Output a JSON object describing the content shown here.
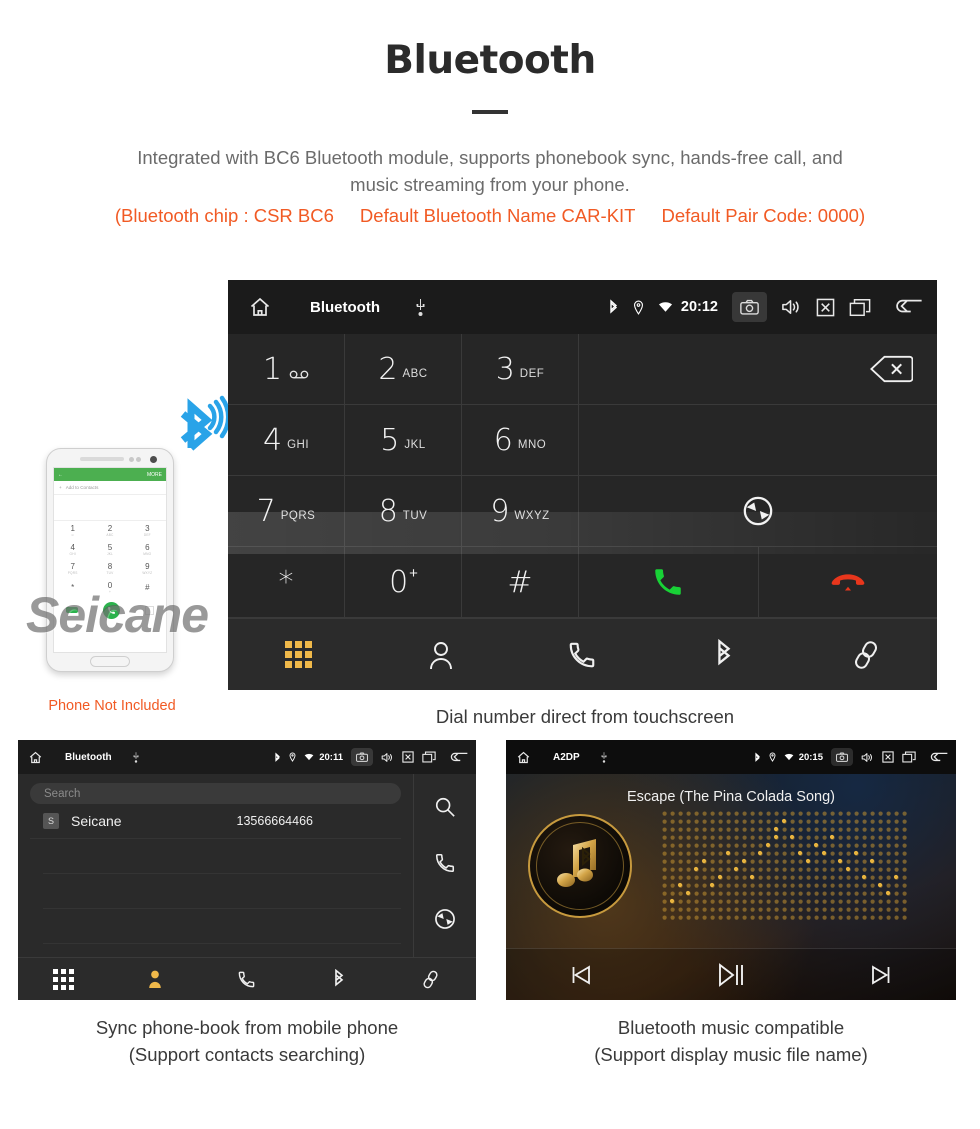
{
  "header": {
    "title": "Bluetooth",
    "intro_line1": "Integrated with BC6 Bluetooth module, supports phonebook sync, hands-free call, and",
    "intro_line2": "music streaming from your phone.",
    "spec_chip": "(Bluetooth chip : CSR BC6",
    "spec_name": "Default Bluetooth Name CAR-KIT",
    "spec_pair": "Default Pair Code: 0000)",
    "accent_color": "#f15a24",
    "text_color": "#6b6b6b"
  },
  "dialer": {
    "statusbar": {
      "title": "Bluetooth",
      "clock": "20:12",
      "icons": [
        "home-icon",
        "usb-icon",
        "bluetooth-icon",
        "location-icon",
        "wifi-icon",
        "camera-icon",
        "volume-icon",
        "close-icon",
        "recent-apps-icon",
        "back-icon"
      ]
    },
    "keys": [
      {
        "digit": "1",
        "letters": "",
        "glyph": "voicemail"
      },
      {
        "digit": "2",
        "letters": "ABC",
        "glyph": ""
      },
      {
        "digit": "3",
        "letters": "DEF",
        "glyph": ""
      },
      {
        "digit": "4",
        "letters": "GHI",
        "glyph": ""
      },
      {
        "digit": "5",
        "letters": "JKL",
        "glyph": ""
      },
      {
        "digit": "6",
        "letters": "MNO",
        "glyph": ""
      },
      {
        "digit": "7",
        "letters": "PQRS",
        "glyph": ""
      },
      {
        "digit": "8",
        "letters": "TUV",
        "glyph": ""
      },
      {
        "digit": "9",
        "letters": "WXYZ",
        "glyph": ""
      },
      {
        "digit": "*",
        "letters": "",
        "glyph": ""
      },
      {
        "digit": "0",
        "letters": "",
        "glyph": "plus"
      },
      {
        "digit": "#",
        "letters": "",
        "glyph": ""
      }
    ],
    "side_actions": {
      "backspace": "backspace-icon",
      "sync": "sync-icon",
      "call": "call-icon",
      "hangup": "hangup-icon",
      "call_color": "#18d136",
      "hangup_color": "#e8361c"
    },
    "navbar": {
      "items": [
        "dialpad",
        "contacts",
        "call-log",
        "bluetooth",
        "pair"
      ],
      "active": "dialpad",
      "active_color": "#f0b94a"
    },
    "caption": "Dial number direct from touchscreen"
  },
  "phone_mockup": {
    "topbar_back": "←",
    "topbar_more": "MORE",
    "add_label": "Add to Contacts",
    "keys": [
      {
        "d": "1",
        "s": "∞"
      },
      {
        "d": "2",
        "s": "ABC"
      },
      {
        "d": "3",
        "s": "DEF"
      },
      {
        "d": "4",
        "s": "GHI"
      },
      {
        "d": "5",
        "s": "JKL"
      },
      {
        "d": "6",
        "s": "MNO"
      },
      {
        "d": "7",
        "s": "PQRS"
      },
      {
        "d": "8",
        "s": "TUV"
      },
      {
        "d": "9",
        "s": "WXYZ"
      },
      {
        "d": "*",
        "s": ""
      },
      {
        "d": "0",
        "s": "+"
      },
      {
        "d": "#",
        "s": ""
      }
    ],
    "not_included": "Phone Not Included",
    "not_included_color": "#f15a24"
  },
  "watermark": {
    "text": "Seicane"
  },
  "phonebook": {
    "statusbar": {
      "title": "Bluetooth",
      "clock": "20:11"
    },
    "search_placeholder": "Search",
    "contact": {
      "initial": "S",
      "name": "Seicane",
      "number": "13566664466"
    },
    "side_actions": [
      "search-icon",
      "call-icon",
      "sync-icon"
    ],
    "navbar": {
      "items": [
        "dialpad",
        "contacts",
        "call-log",
        "bluetooth",
        "pair"
      ],
      "active": "contacts",
      "active_color": "#f0b94a"
    },
    "caption_line1": "Sync phone-book from mobile phone",
    "caption_line2": "(Support contacts searching)"
  },
  "music": {
    "statusbar": {
      "title": "A2DP",
      "clock": "20:15"
    },
    "song_title": "Escape (The Pina Colada Song)",
    "controls": [
      "prev-icon",
      "play-pause-icon",
      "next-icon"
    ],
    "accent_color": "#c79a3e",
    "caption_line1": "Bluetooth music compatible",
    "caption_line2": "(Support display music file name)"
  }
}
